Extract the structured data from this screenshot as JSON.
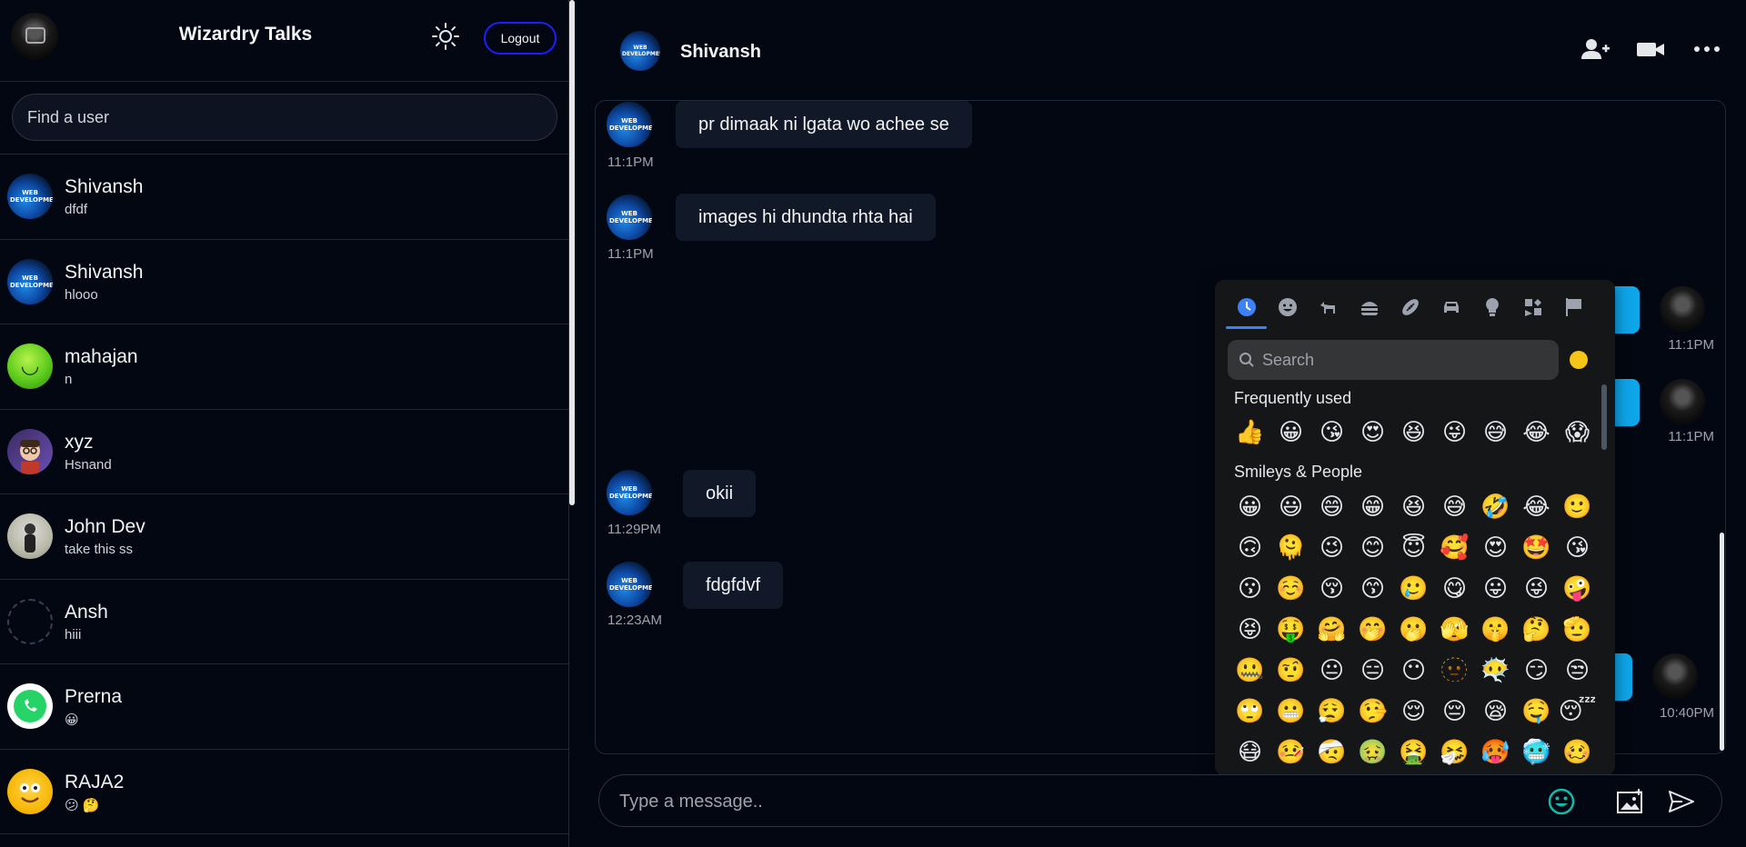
{
  "app": {
    "title": "Wizardry Talks",
    "logout_label": "Logout",
    "search_placeholder": "Find a user"
  },
  "users": [
    {
      "name": "Shivansh",
      "last": "dfdf",
      "avatar": "web-development"
    },
    {
      "name": "Shivansh",
      "last": "hlooo",
      "avatar": "web-development"
    },
    {
      "name": "mahajan",
      "last": "n",
      "avatar": "smiley"
    },
    {
      "name": "xyz",
      "last": "Hsnand",
      "avatar": "cartoon"
    },
    {
      "name": "John Dev",
      "last": "take this ss",
      "avatar": "photo"
    },
    {
      "name": "Ansh",
      "last": "hiii",
      "avatar": "broken-image"
    },
    {
      "name": "Prerna",
      "last": "😀",
      "avatar": "whatsapp"
    },
    {
      "name": "RAJA2",
      "last": "😕 🤔",
      "avatar": "emoji-face"
    }
  ],
  "chat": {
    "contact_name": "Shivansh",
    "avatar_text": "WEB DEVELOPMENT",
    "input_placeholder": "Type a message..",
    "received": [
      {
        "text": "pr dimaak ni lgata wo achee se",
        "time": "11:1PM"
      },
      {
        "text": "images hi dhundta rhta hai",
        "time": "11:1PM"
      },
      {
        "text": "okii",
        "time": "11:29PM"
      },
      {
        "text": "fdgfdvf",
        "time": "12:23AM"
      }
    ],
    "sent": [
      {
        "time": "11:1PM"
      },
      {
        "time": "11:1PM"
      },
      {
        "time": "10:40PM"
      }
    ]
  },
  "emoji_picker": {
    "search_placeholder": "Search",
    "frequently_used_title": "Frequently used",
    "smileys_title": "Smileys & People",
    "tab_icons": [
      "clock-icon",
      "smiley-icon",
      "animal-icon",
      "food-icon",
      "activity-icon",
      "car-icon",
      "lightbulb-icon",
      "symbols-icon",
      "flag-icon"
    ],
    "frequently_used": [
      "👍",
      "😀",
      "😘",
      "😍",
      "😆",
      "😜",
      "😅",
      "😂",
      "😱"
    ],
    "smileys": [
      "😀",
      "😃",
      "😄",
      "😁",
      "😆",
      "😅",
      "🤣",
      "😂",
      "🙂",
      "🙃",
      "🫠",
      "😉",
      "😊",
      "😇",
      "🥰",
      "😍",
      "🤩",
      "😘",
      "😗",
      "☺️",
      "😚",
      "😙",
      "🥲",
      "😋",
      "😛",
      "😜",
      "🤪",
      "😝",
      "🤑",
      "🤗",
      "🤭",
      "🫢",
      "🫣",
      "🤫",
      "🤔",
      "🫡",
      "🤐",
      "🤨",
      "😐",
      "😑",
      "😶",
      "🫥",
      "😶‍🌫️",
      "😏",
      "😒",
      "🙄",
      "😬",
      "😮‍💨",
      "🤥",
      "😌",
      "😔",
      "😪",
      "🤤",
      "😴",
      "😷",
      "🤒",
      "🤕",
      "🤢",
      "🤮",
      "🤧",
      "🥵",
      "🥶",
      "🥴"
    ]
  },
  "colors": {
    "background": "#030712",
    "accent": "#0ea5e9",
    "logout_border": "#1d1dff",
    "picker_bg": "#151617"
  }
}
